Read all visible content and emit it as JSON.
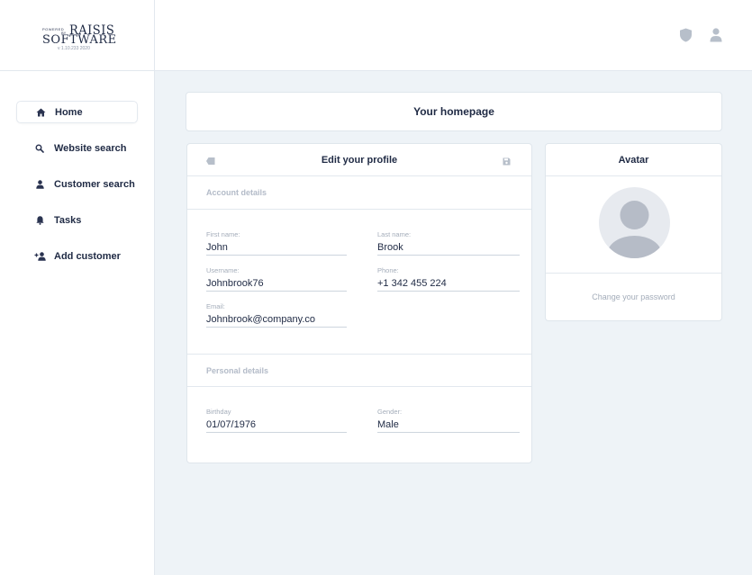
{
  "logo": {
    "powered": "POWERED",
    "by": "BY",
    "brand_top": "RAISIS",
    "brand_bottom": "SOFTWARE",
    "version": "v 1.10.233 2020"
  },
  "sidebar": {
    "items": [
      {
        "label": "Home",
        "icon": "home-icon",
        "active": true
      },
      {
        "label": "Website search",
        "icon": "search-icon",
        "active": false
      },
      {
        "label": "Customer search",
        "icon": "person-icon",
        "active": false
      },
      {
        "label": "Tasks",
        "icon": "bell-icon",
        "active": false
      },
      {
        "label": "Add customer",
        "icon": "add-person-icon",
        "active": false
      }
    ]
  },
  "topbar": {
    "icons": [
      "shield-icon",
      "user-icon"
    ]
  },
  "page": {
    "title": "Your homepage"
  },
  "profile": {
    "title": "Edit your profile",
    "account_section": "Account details",
    "personal_section": "Personal details",
    "fields": {
      "first_name": {
        "label": "First name:",
        "value": "John"
      },
      "last_name": {
        "label": "Last name:",
        "value": "Brook"
      },
      "username": {
        "label": "Username:",
        "value": "Johnbrook76"
      },
      "phone": {
        "label": "Phone:",
        "value": "+1 342 455 224"
      },
      "email": {
        "label": "Email:",
        "value": "Johnbrook@company.co"
      },
      "birthday": {
        "label": "Birthday",
        "value": "01/07/1976"
      },
      "gender": {
        "label": "Gender:",
        "value": "Male"
      }
    }
  },
  "avatar": {
    "title": "Avatar",
    "change_password": "Change your password"
  },
  "colors": {
    "primary_text": "#1f2a44",
    "muted_text": "#a4adba",
    "icon_gray": "#b7bfca",
    "background": "#eef3f7"
  }
}
